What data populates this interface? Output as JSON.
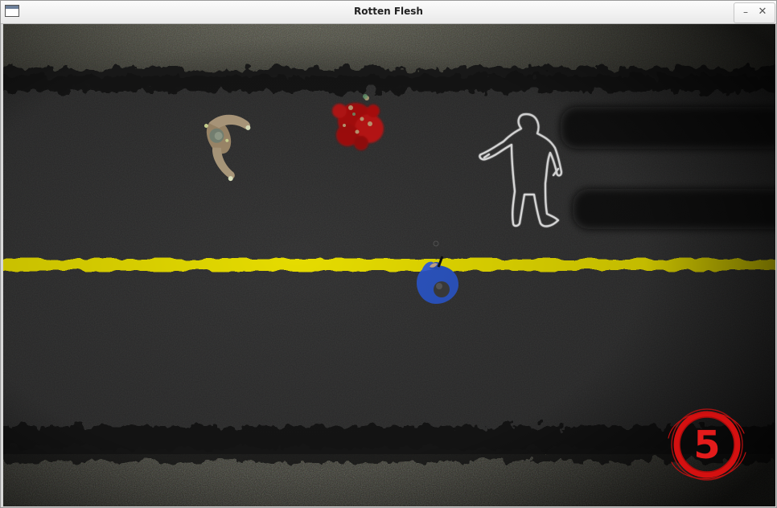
{
  "window": {
    "title": "Rotten Flesh",
    "minimize_glyph": "–",
    "close_glyph": "✕"
  },
  "hud": {
    "level": "5",
    "level_color": "#e01515"
  },
  "scene": {
    "road_color": "#2b2b2b",
    "center_line_color": "#e8e000",
    "grass_color": "#5f5f4e",
    "player_shirt_color": "#2f56c2",
    "zombie_color": "#b8a388",
    "blood_color": "#c41414",
    "chalk_color": "#f2f2f2"
  }
}
